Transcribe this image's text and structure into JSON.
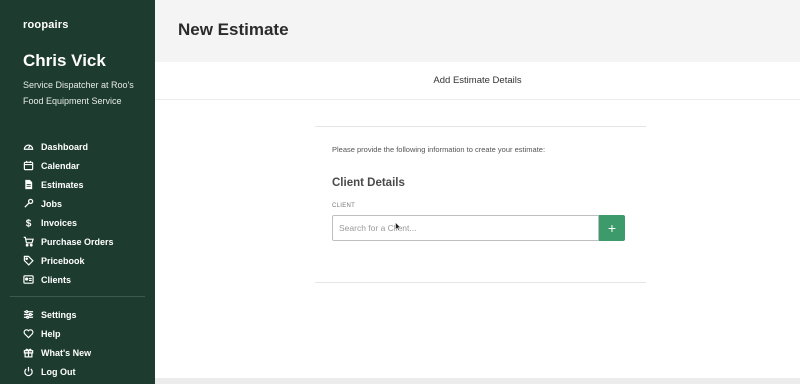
{
  "brand": {
    "logo_text": "roopairs"
  },
  "user": {
    "name": "Chris Vick",
    "role": "Service Dispatcher at Roo's Food Equipment Service"
  },
  "sidebar": {
    "items": [
      {
        "label": "Dashboard",
        "icon": "dashboard-icon"
      },
      {
        "label": "Calendar",
        "icon": "calendar-icon"
      },
      {
        "label": "Estimates",
        "icon": "document-icon"
      },
      {
        "label": "Jobs",
        "icon": "wrench-icon"
      },
      {
        "label": "Invoices",
        "icon": "dollar-icon"
      },
      {
        "label": "Purchase Orders",
        "icon": "cart-icon"
      },
      {
        "label": "Pricebook",
        "icon": "tag-icon"
      },
      {
        "label": "Clients",
        "icon": "id-card-icon"
      }
    ],
    "bottom_items": [
      {
        "label": "Settings",
        "icon": "sliders-icon"
      },
      {
        "label": "Help",
        "icon": "heart-icon"
      },
      {
        "label": "What's New",
        "icon": "gift-icon"
      },
      {
        "label": "Log Out",
        "icon": "power-icon"
      }
    ]
  },
  "header": {
    "title": "New Estimate"
  },
  "section": {
    "title": "Add Estimate Details"
  },
  "form": {
    "intro": "Please provide the following information to create your estimate:",
    "client_heading": "Client Details",
    "client_label": "CLIENT",
    "search_placeholder": "Search for a Client...",
    "search_value": "",
    "add_button_label": "+"
  },
  "colors": {
    "sidebar_bg": "#1e3b30",
    "accent": "#3d9a6a",
    "topbar_bg": "#f4f4f4"
  }
}
